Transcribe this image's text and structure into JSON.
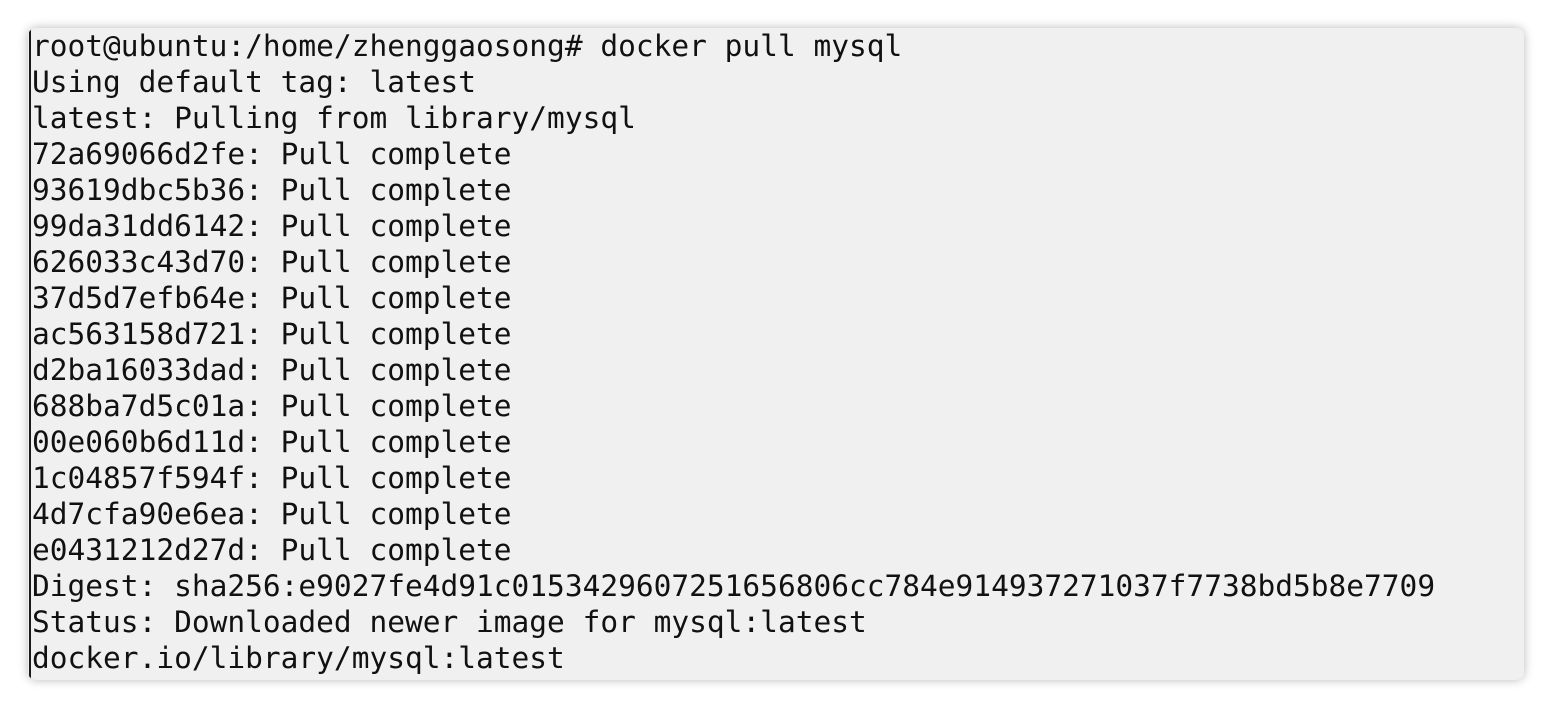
{
  "terminal": {
    "lines": [
      "root@ubuntu:/home/zhenggaosong# docker pull mysql",
      "Using default tag: latest",
      "latest: Pulling from library/mysql",
      "72a69066d2fe: Pull complete",
      "93619dbc5b36: Pull complete",
      "99da31dd6142: Pull complete",
      "626033c43d70: Pull complete",
      "37d5d7efb64e: Pull complete",
      "ac563158d721: Pull complete",
      "d2ba16033dad: Pull complete",
      "688ba7d5c01a: Pull complete",
      "00e060b6d11d: Pull complete",
      "1c04857f594f: Pull complete",
      "4d7cfa90e6ea: Pull complete",
      "e0431212d27d: Pull complete",
      "Digest: sha256:e9027fe4d91c0153429607251656806cc784e914937271037f7738bd5b8e7709",
      "Status: Downloaded newer image for mysql:latest",
      "docker.io/library/mysql:latest"
    ]
  },
  "colors": {
    "background": "#f0f0f0",
    "foreground": "#111111"
  }
}
